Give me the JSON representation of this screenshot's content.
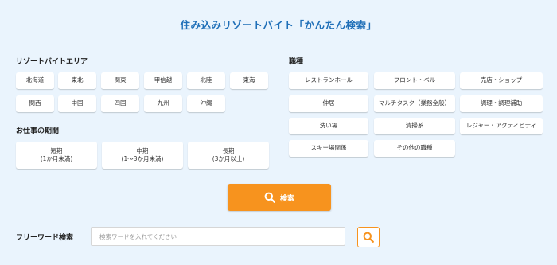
{
  "page_title": "住み込みリゾートバイト「かんたん検索」",
  "area": {
    "label": "リゾートバイトエリア",
    "items": [
      "北海道",
      "東北",
      "関東",
      "甲信越",
      "北陸",
      "東海",
      "関西",
      "中国",
      "四国",
      "九州",
      "沖縄"
    ]
  },
  "period": {
    "label": "お仕事の期間",
    "items": [
      "短期\n(1か月未満)",
      "中期\n(1〜3か月未満)",
      "長期\n(3か月以上)"
    ]
  },
  "job_type": {
    "label": "職種",
    "items": [
      "レストランホール",
      "フロント・ベル",
      "売店・ショップ",
      "仲居",
      "マルチタスク（業務全般）",
      "調理・調理補助",
      "洗い場",
      "清掃系",
      "レジャー・アクティビティ",
      "スキー場関係",
      "その他の職種"
    ]
  },
  "search_button": {
    "label": "検索"
  },
  "free_word": {
    "label": "フリーワード検索",
    "placeholder": "検索ワードを入れてください",
    "value": ""
  },
  "colors": {
    "background": "#eaf4fd",
    "title": "#1f6fb8",
    "accent": "#f7931e"
  },
  "icons": {
    "search_button": "search-icon",
    "free_word_button": "search-icon"
  }
}
